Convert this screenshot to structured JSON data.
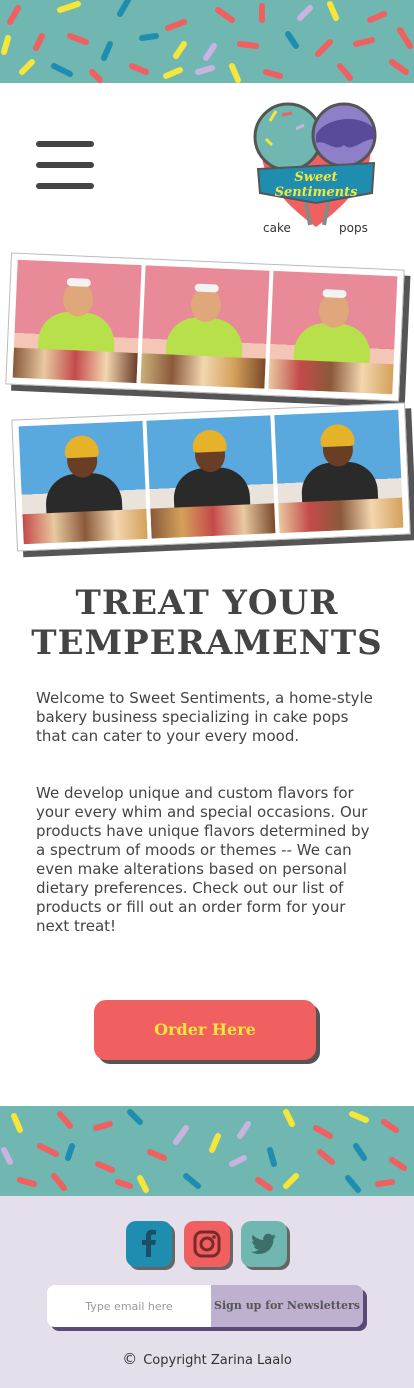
{
  "brand": {
    "logo_line1": "Sweet",
    "logo_line2": "Sentiments",
    "logo_left": "cake",
    "logo_right": "pops"
  },
  "hero": {
    "title_line1": "TREAT YOUR",
    "title_line2": "TEMPERAMENTS"
  },
  "intro": {
    "paragraph1": "Welcome to Sweet Sentiments, a home-style bakery business specializing in cake pops that can cater to your every mood.",
    "paragraph2": "We develop unique and custom flavors for your every whim and special occasions. Our products have unique flavors determined by a spectrum of moods or themes -- We can even make alterations based on personal dietary preferences. Check out our list of products or fill out an order form for your next treat!"
  },
  "cta": {
    "order_label": "Order Here"
  },
  "footer": {
    "email_placeholder": "Type email here",
    "signup_label": "Sign up for Newsletters",
    "copyright_symbol": "©",
    "copyright_text": "Copyright Zarina Laalo"
  },
  "colors": {
    "teal": "#6fb7b0",
    "coral": "#f06060",
    "yellow": "#f6e63a",
    "lavender": "#e4dfeb",
    "facebook": "#1f8db0"
  },
  "icons": [
    "hamburger-icon",
    "facebook-icon",
    "instagram-icon",
    "twitter-icon",
    "copyright-icon"
  ]
}
